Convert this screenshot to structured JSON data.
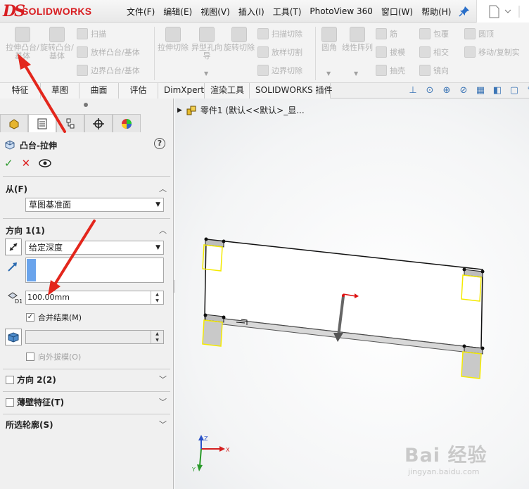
{
  "app": {
    "logo_text": "SOLIDWORKS",
    "logo_mark": "DS"
  },
  "menu": [
    "文件(F)",
    "编辑(E)",
    "视图(V)",
    "插入(I)",
    "工具(T)",
    "PhotoView 360",
    "窗口(W)",
    "帮助(H)"
  ],
  "ribbon": {
    "big": [
      {
        "name": "extrude-boss",
        "label": "拉伸凸台/基体"
      },
      {
        "name": "revolve-boss",
        "label": "旋转凸台/基体"
      },
      {
        "name": "extrude-cut",
        "label": "拉伸切除"
      },
      {
        "name": "hole-wizard",
        "label": "异型孔向导"
      },
      {
        "name": "revolve-cut",
        "label": "旋转切除"
      },
      {
        "name": "fillet",
        "label": "圆角"
      },
      {
        "name": "linear-pattern",
        "label": "线性阵列"
      }
    ],
    "small": [
      {
        "name": "sweep",
        "label": "扫描"
      },
      {
        "name": "loft-boss",
        "label": "放样凸台/基体"
      },
      {
        "name": "boundary-boss",
        "label": "边界凸台/基体"
      },
      {
        "name": "swept-cut",
        "label": "扫描切除"
      },
      {
        "name": "lofted-cut",
        "label": "放样切割"
      },
      {
        "name": "boundary-cut",
        "label": "边界切除"
      },
      {
        "name": "rib",
        "label": "筋"
      },
      {
        "name": "draft",
        "label": "拔模"
      },
      {
        "name": "shell",
        "label": "抽壳"
      },
      {
        "name": "wrap",
        "label": "包覆"
      },
      {
        "name": "intersect",
        "label": "相交"
      },
      {
        "name": "mirror",
        "label": "镜向"
      },
      {
        "name": "dome",
        "label": "圆顶"
      },
      {
        "name": "move-copy",
        "label": "移动/复制实"
      }
    ]
  },
  "tabs": [
    "特征",
    "草图",
    "曲面",
    "评估",
    "DimXpert",
    "渲染工具",
    "SOLIDWORKS 插件"
  ],
  "tree": {
    "root_label": "零件1  (默认<<默认>_显..."
  },
  "property_manager": {
    "title": "凸台-拉伸",
    "help": "?",
    "from": {
      "title": "从(F)",
      "value": "草图基准面"
    },
    "direction1": {
      "title": "方向 1(1)",
      "end_condition": "给定深度",
      "depth": "100.00mm",
      "merge_label": "合并结果(M)",
      "merge_checked": "✓",
      "draft_outward": "向外拔模(O)"
    },
    "direction2": {
      "title": "方向 2(2)"
    },
    "thin_feature": {
      "title": "薄壁特征(T)"
    },
    "selected_contours": {
      "title": "所选轮廓(S)"
    }
  },
  "watermark": {
    "main": "Bai 经验",
    "sub": "jingyan.baidu.com"
  },
  "triad": {
    "x": "X",
    "y": "Y",
    "z": "Z"
  },
  "colors": {
    "brand": "#d81e22",
    "annotation_arrow": "#e3261c",
    "preview_yellow": "#f4ea00",
    "check_green": "#2e9a2e"
  }
}
